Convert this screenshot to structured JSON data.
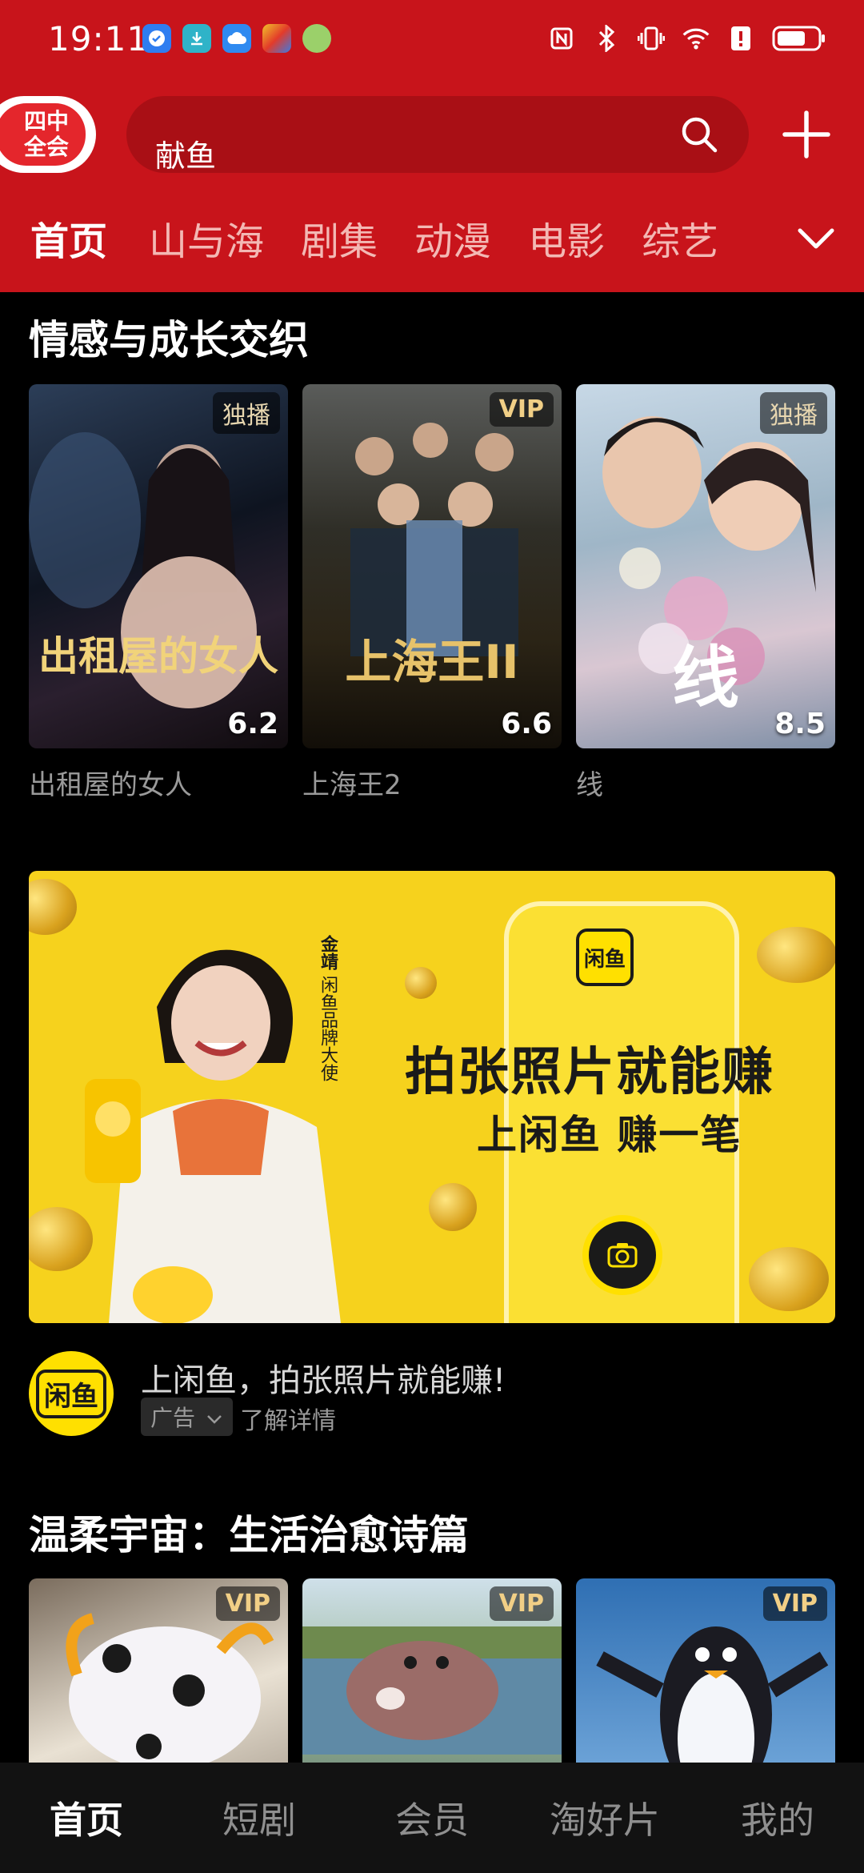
{
  "status_bar": {
    "time": "19:11",
    "app_icons": [
      "checkmark-app-icon",
      "download-app-icon",
      "cloud-app-icon",
      "game-app-icon",
      "ball-app-icon"
    ],
    "right_icons": [
      "nfc-icon",
      "bluetooth-icon",
      "vibrate-icon",
      "wifi-icon",
      "alert-icon",
      "battery-icon"
    ]
  },
  "header": {
    "badge_text": "四中\n全会",
    "search_text": "献鱼",
    "tabs": [
      {
        "label": "首页",
        "active": true
      },
      {
        "label": "山与海"
      },
      {
        "label": "剧集"
      },
      {
        "label": "动漫"
      },
      {
        "label": "电影"
      },
      {
        "label": "综艺"
      }
    ]
  },
  "section1": {
    "title": "情感与成长交织",
    "cards": [
      {
        "title": "出租屋的女人",
        "tag": "独播",
        "score": "6.2",
        "art": "出租屋的女人"
      },
      {
        "title": "上海王2",
        "tag": "VIP",
        "score": "6.6",
        "art": "上海王II"
      },
      {
        "title": "线",
        "tag": "独播",
        "score": "8.5",
        "art": "线"
      }
    ]
  },
  "ad": {
    "headline": "拍张照片就能赚",
    "subline": "上闲鱼 赚一笔",
    "logo_text": "闲鱼",
    "spokesperson": "金靖",
    "spokesperson_role": "闲鱼品牌大使",
    "title": "上闲鱼，拍张照片就能赚!",
    "tag": "广告",
    "more": "了解详情"
  },
  "section2": {
    "title": "温柔宇宙：生活治愈诗篇",
    "cards": [
      {
        "tag": "VIP"
      },
      {
        "tag": "VIP"
      },
      {
        "tag": "VIP"
      }
    ]
  },
  "bottom_nav": [
    {
      "label": "首页",
      "active": true
    },
    {
      "label": "短剧"
    },
    {
      "label": "会员"
    },
    {
      "label": "淘好片"
    },
    {
      "label": "我的"
    }
  ]
}
